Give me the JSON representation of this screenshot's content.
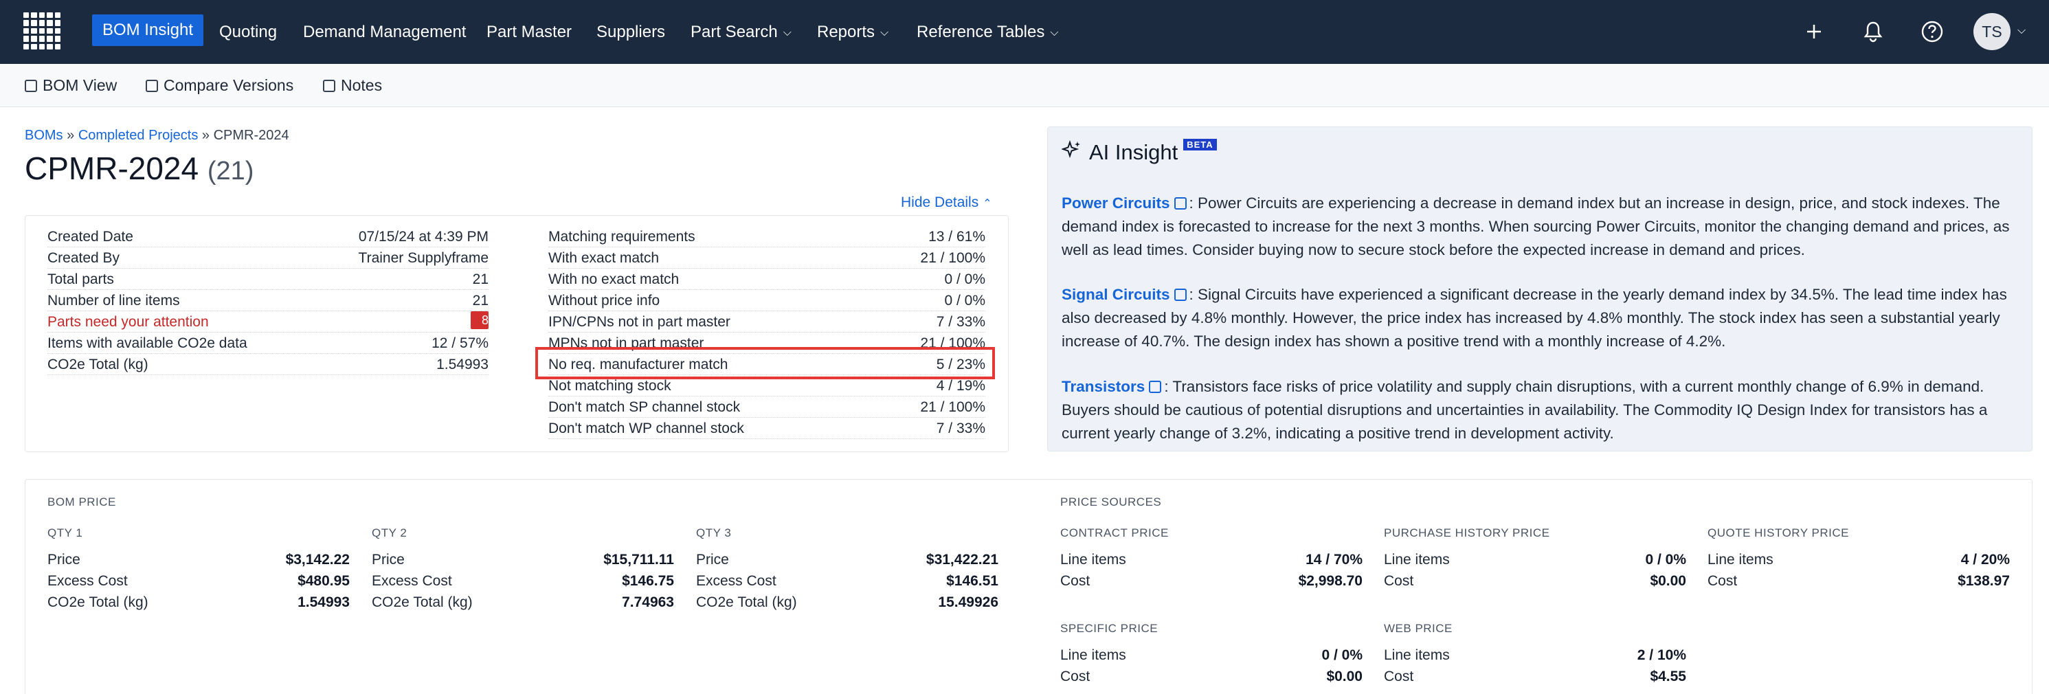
{
  "nav": {
    "items": [
      {
        "label": "BOM Insight"
      },
      {
        "label": "Quoting"
      },
      {
        "label": "Demand Management"
      },
      {
        "label": "Part Master"
      },
      {
        "label": "Suppliers"
      },
      {
        "label": "Part Search"
      },
      {
        "label": "Reports"
      },
      {
        "label": "Reference Tables"
      }
    ],
    "avatar": "TS"
  },
  "toolbar": {
    "bom_view": "BOM View",
    "compare_versions": "Compare Versions",
    "notes": "Notes"
  },
  "breadcrumb": {
    "boms": "BOMs",
    "sep1": "»",
    "completed_projects": "Completed Projects",
    "sep2": "»",
    "current": "CPMR-2024"
  },
  "title": {
    "name": "CPMR-2024",
    "count": "(21)"
  },
  "hide_details": "Hide Details",
  "details": {
    "left": [
      {
        "label": "Created Date",
        "value": "07/15/24 at 4:39 PM"
      },
      {
        "label": "Created By",
        "value": "Trainer Supplyframe"
      },
      {
        "label": "Total parts",
        "value": "21"
      },
      {
        "label": "Number of line items",
        "value": "21"
      },
      {
        "label": "Parts need your attention",
        "value": "8"
      },
      {
        "label": "Items with available CO2e data",
        "value": "12 / 57%"
      },
      {
        "label": "CO2e Total (kg)",
        "value": "1.54993"
      }
    ],
    "right": [
      {
        "label": "Matching requirements",
        "value": "13 / 61%"
      },
      {
        "label": "With exact match",
        "value": "21 / 100%"
      },
      {
        "label": "With no exact match",
        "value": "0 / 0%"
      },
      {
        "label": "Without price info",
        "value": "0 / 0%"
      },
      {
        "label": "IPN/CPNs not in part master",
        "value": "7 / 33%"
      },
      {
        "label": "MPNs not in part master",
        "value": "21 / 100%"
      },
      {
        "label": "No req. manufacturer match",
        "value": "5 / 23%"
      },
      {
        "label": "Not matching stock",
        "value": "4 / 19%"
      },
      {
        "label": "Don't match SP channel stock",
        "value": "21 / 100%"
      },
      {
        "label": "Don't match WP channel stock",
        "value": "7 / 33%"
      }
    ]
  },
  "ai": {
    "title": "AI Insight",
    "beta": "BETA",
    "items": [
      {
        "topic": "Power Circuits",
        "text": ": Power Circuits are experiencing a decrease in demand index but an increase in design, price, and stock indexes. The demand index is forecasted to increase for the next 3 months. When sourcing Power Circuits, monitor the changing demand and prices, as well as lead times. Consider buying now to secure stock before the expected increase in demand and prices."
      },
      {
        "topic": "Signal Circuits",
        "text": ": Signal Circuits have experienced a significant decrease in the yearly demand index by 34.5%. The lead time index has also decreased by 4.8% monthly. However, the price index has increased by 4.8% monthly. The stock index has seen a substantial yearly increase of 40.7%. The design index has shown a positive trend with a monthly increase of 4.2%."
      },
      {
        "topic": "Transistors",
        "text": ": Transistors face risks of price volatility and supply chain disruptions, with a current monthly change of 6.9% in demand. Buyers should be cautious of potential disruptions and uncertainties in availability. The Commodity IQ Design Index for transistors has a current yearly change of 3.2%, indicating a positive trend in development activity."
      }
    ]
  },
  "bom_price": {
    "heading": "BOM PRICE",
    "qtys": [
      {
        "label": "QTY 1",
        "rows": [
          {
            "k": "Price",
            "v": "$3,142.22"
          },
          {
            "k": "Excess Cost",
            "v": "$480.95"
          },
          {
            "k": "CO2e Total (kg)",
            "v": "1.54993"
          }
        ]
      },
      {
        "label": "QTY 2",
        "rows": [
          {
            "k": "Price",
            "v": "$15,711.11"
          },
          {
            "k": "Excess Cost",
            "v": "$146.75"
          },
          {
            "k": "CO2e Total (kg)",
            "v": "7.74963"
          }
        ]
      },
      {
        "label": "QTY 3",
        "rows": [
          {
            "k": "Price",
            "v": "$31,422.21"
          },
          {
            "k": "Excess Cost",
            "v": "$146.51"
          },
          {
            "k": "CO2e Total (kg)",
            "v": "15.49926"
          }
        ]
      }
    ]
  },
  "price_sources": {
    "heading": "PRICE SOURCES",
    "groups": [
      {
        "label": "CONTRACT PRICE",
        "rows": [
          {
            "k": "Line items",
            "v": "14 / 70%"
          },
          {
            "k": "Cost",
            "v": "$2,998.70"
          }
        ]
      },
      {
        "label": "PURCHASE HISTORY PRICE",
        "rows": [
          {
            "k": "Line items",
            "v": "0 / 0%"
          },
          {
            "k": "Cost",
            "v": "$0.00"
          }
        ]
      },
      {
        "label": "QUOTE HISTORY PRICE",
        "rows": [
          {
            "k": "Line items",
            "v": "4 / 20%"
          },
          {
            "k": "Cost",
            "v": "$138.97"
          }
        ]
      },
      {
        "label": "SPECIFIC PRICE",
        "rows": [
          {
            "k": "Line items",
            "v": "0 / 0%"
          },
          {
            "k": "Cost",
            "v": "$0.00"
          }
        ]
      },
      {
        "label": "WEB PRICE",
        "rows": [
          {
            "k": "Line items",
            "v": "2 / 10%"
          },
          {
            "k": "Cost",
            "v": "$4.55"
          }
        ]
      }
    ]
  }
}
